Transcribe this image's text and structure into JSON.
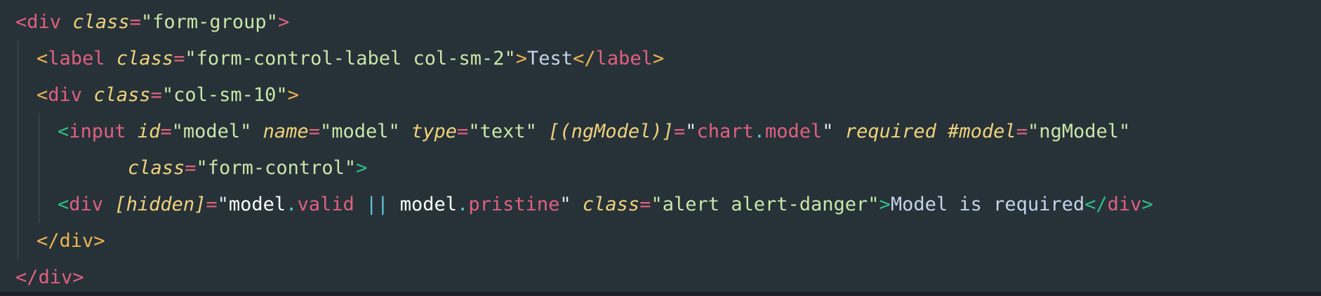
{
  "editor": {
    "lines": [
      {
        "indent": 0,
        "tokens": [
          {
            "t": "<",
            "c": "tk-bracket-red"
          },
          {
            "t": "div",
            "c": "tk-tag"
          },
          {
            "t": " ",
            "c": "tk-plain"
          },
          {
            "t": "class",
            "c": "tk-attr"
          },
          {
            "t": "=",
            "c": "tk-eq"
          },
          {
            "t": "\"form-group\"",
            "c": "tk-string"
          },
          {
            "t": ">",
            "c": "tk-bracket-red"
          }
        ]
      },
      {
        "indent": 1,
        "tokens": [
          {
            "t": "<",
            "c": "tk-bracket-orange"
          },
          {
            "t": "label",
            "c": "tk-tag"
          },
          {
            "t": " ",
            "c": "tk-plain"
          },
          {
            "t": "class",
            "c": "tk-attr"
          },
          {
            "t": "=",
            "c": "tk-eq"
          },
          {
            "t": "\"form-control-label col-sm-2\"",
            "c": "tk-string"
          },
          {
            "t": ">",
            "c": "tk-bracket-orange"
          },
          {
            "t": "Test",
            "c": "tk-text"
          },
          {
            "t": "</",
            "c": "tk-bracket-orange"
          },
          {
            "t": "label",
            "c": "tk-tag"
          },
          {
            "t": ">",
            "c": "tk-bracket-orange"
          }
        ]
      },
      {
        "indent": 1,
        "tokens": [
          {
            "t": "<",
            "c": "tk-bracket-orange"
          },
          {
            "t": "div",
            "c": "tk-tag"
          },
          {
            "t": " ",
            "c": "tk-plain"
          },
          {
            "t": "class",
            "c": "tk-attr"
          },
          {
            "t": "=",
            "c": "tk-eq"
          },
          {
            "t": "\"col-sm-10\"",
            "c": "tk-string"
          },
          {
            "t": ">",
            "c": "tk-bracket-orange"
          }
        ]
      },
      {
        "indent": 2,
        "tokens": [
          {
            "t": "<",
            "c": "tk-bracket-green"
          },
          {
            "t": "input",
            "c": "tk-tag"
          },
          {
            "t": " ",
            "c": "tk-plain"
          },
          {
            "t": "id",
            "c": "tk-attr"
          },
          {
            "t": "=",
            "c": "tk-eq"
          },
          {
            "t": "\"model\"",
            "c": "tk-string"
          },
          {
            "t": " ",
            "c": "tk-plain"
          },
          {
            "t": "name",
            "c": "tk-attr"
          },
          {
            "t": "=",
            "c": "tk-eq"
          },
          {
            "t": "\"model\"",
            "c": "tk-string"
          },
          {
            "t": " ",
            "c": "tk-plain"
          },
          {
            "t": "type",
            "c": "tk-attr"
          },
          {
            "t": "=",
            "c": "tk-eq"
          },
          {
            "t": "\"text\"",
            "c": "tk-string"
          },
          {
            "t": " ",
            "c": "tk-plain"
          },
          {
            "t": "[(ngModel)]",
            "c": "tk-attr"
          },
          {
            "t": "=",
            "c": "tk-eq"
          },
          {
            "t": "\"",
            "c": "tk-quote"
          },
          {
            "t": "chart",
            "c": "tk-prop"
          },
          {
            "t": ".",
            "c": "tk-dot"
          },
          {
            "t": "model",
            "c": "tk-prop"
          },
          {
            "t": "\"",
            "c": "tk-quote"
          },
          {
            "t": " ",
            "c": "tk-plain"
          },
          {
            "t": "required",
            "c": "tk-attr"
          },
          {
            "t": " ",
            "c": "tk-plain"
          },
          {
            "t": "#model",
            "c": "tk-attr"
          },
          {
            "t": "=",
            "c": "tk-eq"
          },
          {
            "t": "\"ngModel\"",
            "c": "tk-string"
          }
        ]
      },
      {
        "indent": 2,
        "continuation": true,
        "tokens": [
          {
            "t": "class",
            "c": "tk-attr"
          },
          {
            "t": "=",
            "c": "tk-eq"
          },
          {
            "t": "\"form-control\"",
            "c": "tk-string"
          },
          {
            "t": ">",
            "c": "tk-bracket-green"
          }
        ]
      },
      {
        "indent": 2,
        "tokens": [
          {
            "t": "<",
            "c": "tk-bracket-green"
          },
          {
            "t": "div",
            "c": "tk-tag"
          },
          {
            "t": " ",
            "c": "tk-plain"
          },
          {
            "t": "[hidden]",
            "c": "tk-attr"
          },
          {
            "t": "=",
            "c": "tk-eq"
          },
          {
            "t": "\"",
            "c": "tk-quote"
          },
          {
            "t": "model",
            "c": "tk-ident"
          },
          {
            "t": ".",
            "c": "tk-dot"
          },
          {
            "t": "valid",
            "c": "tk-prop"
          },
          {
            "t": " ",
            "c": "tk-plain"
          },
          {
            "t": "||",
            "c": "tk-op"
          },
          {
            "t": " ",
            "c": "tk-plain"
          },
          {
            "t": "model",
            "c": "tk-ident"
          },
          {
            "t": ".",
            "c": "tk-dot"
          },
          {
            "t": "pristine",
            "c": "tk-prop"
          },
          {
            "t": "\"",
            "c": "tk-quote"
          },
          {
            "t": " ",
            "c": "tk-plain"
          },
          {
            "t": "class",
            "c": "tk-attr"
          },
          {
            "t": "=",
            "c": "tk-eq"
          },
          {
            "t": "\"alert alert-danger\"",
            "c": "tk-string"
          },
          {
            "t": ">",
            "c": "tk-bracket-green"
          },
          {
            "t": "Model is required",
            "c": "tk-text"
          },
          {
            "t": "</",
            "c": "tk-bracket-green"
          },
          {
            "t": "div",
            "c": "tk-tag"
          },
          {
            "t": ">",
            "c": "tk-bracket-green"
          }
        ]
      },
      {
        "indent": 1,
        "tokens": [
          {
            "t": "</",
            "c": "tk-bracket-orange"
          },
          {
            "t": "div",
            "c": "tk-tag-orange"
          },
          {
            "t": ">",
            "c": "tk-bracket-orange"
          }
        ]
      },
      {
        "indent": 0,
        "tokens": [
          {
            "t": "</",
            "c": "tk-bracket-red"
          },
          {
            "t": "div",
            "c": "tk-tag"
          },
          {
            "t": ">",
            "c": "tk-bracket-red"
          }
        ]
      }
    ]
  },
  "colors": {
    "background": "#263238",
    "tag": "#e0607e",
    "attribute": "#f0d27a",
    "string": "#c9e6a8",
    "bracket_level_1": "#e0607e",
    "bracket_level_2": "#f0b14f",
    "bracket_level_3": "#2fbf8a"
  }
}
